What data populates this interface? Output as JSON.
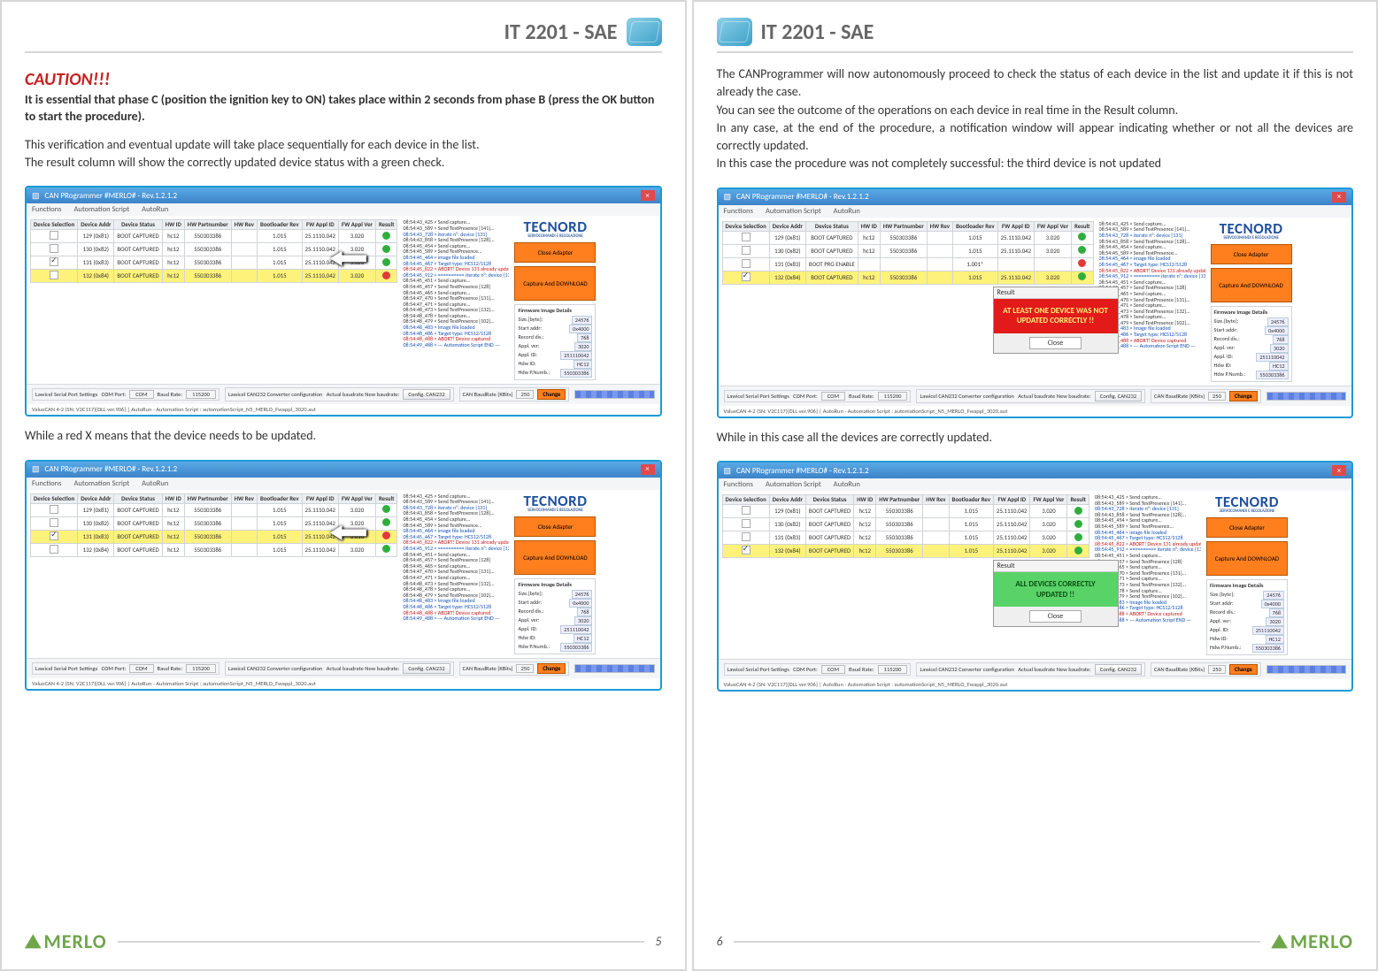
{
  "doc_title": "IT 2201 - SAE",
  "p5": {
    "caution": "CAUTION!!!",
    "caution_bold": "It is essential that phase C (position the ignition key to ON) takes place within 2 seconds from phase B (press the OK button to start the procedure).",
    "p1": "This verification and eventual update will take place sequentially for each device in the list.",
    "p2": "The result column will show the correctly updated device status with a green check.",
    "mid": "While a red X means that the device needs to be updated.",
    "num": "5"
  },
  "p6": {
    "p1": "The CANProgrammer will now autonomously proceed to check the status of each device in the list and update it if this is not already the case.",
    "p2": "You can see the outcome of the operations on each device in real time in the Result column.",
    "p3": "In any case, at the end of the procedure, a notification window will appear indicating whether or not all the devices are correctly updated.",
    "p4": "In this case the procedure was not completely successful: the third device is not updated",
    "mid": "While in this case all the devices are correctly updated.",
    "num": "6"
  },
  "win": {
    "title": "CAN PRogrammer #MERLO# - Rev.1.2.1.2",
    "menu": [
      "Functions",
      "Automation Script",
      "AutoRun"
    ],
    "headers": [
      "Device Selection",
      "Device Addr",
      "Device Status",
      "HW ID",
      "HW Partnumber",
      "HW Rev",
      "Bootloader Rev",
      "FW Appl ID",
      "FW Appl Ver",
      "Result"
    ],
    "btn_close_adapter": "Close Adapter",
    "btn_capture": "Capture And DOWNLOAD",
    "fw_panel_title": "Firmware Image Details",
    "fw_rows": [
      [
        "Size.[byte]:",
        "24576"
      ],
      [
        "Start addr:",
        "0x4000"
      ],
      [
        "Record dis.:",
        "768"
      ],
      [
        "Appl. ver:",
        "3020"
      ],
      [
        "Appl. ID:",
        "251110042"
      ],
      [
        "Hdw ID:",
        "HC12"
      ],
      [
        "Hdw P.Numb.:",
        "550303386"
      ]
    ],
    "tecnord_sub": "SERVOCOMANDI E REGOLAZIONE",
    "bar": {
      "g1": "Lawicel Serial Port Settings",
      "g1a": "COM Port:",
      "g1b": "Baud Rate:",
      "g2": "Lawicel CAN232 Converter configuration",
      "g2a": "Actual baudrate",
      "g2b": "New baudrate:",
      "g2btn": "Config. CAN232",
      "g3": "CAN BaudRate [KBits]",
      "g3val": "250",
      "g3btn": "Change"
    },
    "caption": "ValueCAN 4-2 (SN: V2C117)[DLL ver.906] | AutoRun - Automation Script : automationScript_N5_MERLO_Fwappl_3020.aut"
  },
  "s1": {
    "rows": [
      {
        "sel": false,
        "addr": "129  (0x81)",
        "status": "BOOT CAPTURED",
        "hw": "hc12",
        "pn": "550303386",
        "rev": "",
        "bl": "1.015",
        "id": "25.1110.042",
        "ver": "3.020",
        "ok": true,
        "hi": false
      },
      {
        "sel": false,
        "addr": "130  (0x82)",
        "status": "BOOT CAPTURED",
        "hw": "hc12",
        "pn": "550303386",
        "rev": "",
        "bl": "1.015",
        "id": "25.1110.042",
        "ver": "3.020",
        "ok": true,
        "hi": false
      },
      {
        "sel": true,
        "addr": "131  (0x83)",
        "status": "BOOT CAPTURED",
        "hw": "hc12",
        "pn": "550303386",
        "rev": "",
        "bl": "1.015",
        "id": "25.1110.042",
        "ver": "3.020",
        "ok": true,
        "hi": false
      },
      {
        "sel": false,
        "addr": "132  (0x84)",
        "status": "BOOT CAPTURED",
        "hw": "hc12",
        "pn": "550303386",
        "rev": "",
        "bl": "1.015",
        "id": "25.1110.042",
        "ver": "3.020",
        "ok": false,
        "hi": true
      }
    ],
    "log": [
      "08:54:43_425 > Send capture...",
      "08:54:43_589 > Send TestPresence [141]...",
      "08:54:43_728 > iterate n°: device [131]",
      "08:54:43_858 > Send TestPresence [128]...",
      "08:54:45_454 > Send capture...",
      "08:54:45_589 > Send TestPresence...",
      "08:54:45_464 > image file loaded",
      "08:54:45_467 > Target type: HCS12/S128",
      "08:54:45_822 > ABORT! Device 131 already updated",
      "08:54:45_912 > ========== iterate n°: device [132]",
      "08:54:45_451 > Send capture...",
      "08:54:45_457 > Send TestPresence [128]",
      "08:54:45_465 > Send capture...",
      "08:54:47_470 > Send TestPresence [131]...",
      "08:54:47_471 > Send capture...",
      "08:54:48_473 > Send TestPresence [132]...",
      "08:54:48_478 > Send capture...",
      "08:54:48_479 > Send TestPresence [102]...",
      "08:54:48_483 > Image file loaded",
      "08:54:48_486 > Target type: HCS12/S128",
      "08:54:48_488 > ABORT! Device captured",
      "08:54:49_488 > --- Automation Script END ---"
    ]
  },
  "s2": {
    "rows": [
      {
        "sel": false,
        "addr": "129  (0x81)",
        "status": "BOOT CAPTURED",
        "hw": "hc12",
        "pn": "550303386",
        "rev": "",
        "bl": "1.015",
        "id": "25.1110.042",
        "ver": "3.020",
        "ok": true,
        "hi": false
      },
      {
        "sel": false,
        "addr": "130  (0x82)",
        "status": "BOOT CAPTURED",
        "hw": "hc12",
        "pn": "550303386",
        "rev": "",
        "bl": "1.015",
        "id": "25.1110.042",
        "ver": "3.020",
        "ok": true,
        "hi": false
      },
      {
        "sel": true,
        "addr": "131  (0x83)",
        "status": "BOOT CAPTURED",
        "hw": "hc12",
        "pn": "550303386",
        "rev": "",
        "bl": "1.015",
        "id": "25.1110.042",
        "ver": "3.010",
        "ok": false,
        "hi": true
      },
      {
        "sel": false,
        "addr": "132  (0x84)",
        "status": "BOOT CAPTURED",
        "hw": "hc12",
        "pn": "550303386",
        "rev": "",
        "bl": "1.015",
        "id": "25.1110.042",
        "ver": "3.020",
        "ok": true,
        "hi": false
      }
    ]
  },
  "s3": {
    "rows": [
      {
        "sel": false,
        "addr": "129  (0x81)",
        "status": "BOOT CAPTURED",
        "hw": "hc12",
        "pn": "550303386",
        "rev": "",
        "bl": "1.015",
        "id": "25.1110.042",
        "ver": "3.020",
        "ok": true,
        "hi": false
      },
      {
        "sel": false,
        "addr": "130  (0x82)",
        "status": "BOOT CAPTURED",
        "hw": "hc12",
        "pn": "550303386",
        "rev": "",
        "bl": "1.015",
        "id": "25.1110.042",
        "ver": "3.020",
        "ok": true,
        "hi": false
      },
      {
        "sel": false,
        "addr": "131  (0x83)",
        "status": "BOOT PRG ENABLE",
        "hw": "",
        "pn": "",
        "rev": "",
        "bl": "1.001*",
        "id": "",
        "ver": "",
        "ok": false,
        "hi": false
      },
      {
        "sel": true,
        "addr": "132  (0x84)",
        "status": "BOOT CAPTURED",
        "hw": "hc12",
        "pn": "550303386",
        "rev": "",
        "bl": "1.015",
        "id": "25.1110.042",
        "ver": "3.020",
        "ok": true,
        "hi": true
      }
    ],
    "modal_title": "Result",
    "modal_body": "AT LEAST ONE DEVICE WAS NOT UPDATED CORRECTLY !!",
    "modal_close": "Close"
  },
  "s4": {
    "rows": [
      {
        "sel": false,
        "addr": "129  (0x81)",
        "status": "BOOT CAPTURED",
        "hw": "hc12",
        "pn": "550303386",
        "rev": "",
        "bl": "1.015",
        "id": "25.1110.042",
        "ver": "3.020",
        "ok": true,
        "hi": false
      },
      {
        "sel": false,
        "addr": "130  (0x82)",
        "status": "BOOT CAPTURED",
        "hw": "hc12",
        "pn": "550303386",
        "rev": "",
        "bl": "1.015",
        "id": "25.1110.042",
        "ver": "3.020",
        "ok": true,
        "hi": false
      },
      {
        "sel": false,
        "addr": "131  (0x83)",
        "status": "BOOT CAPTURED",
        "hw": "hc12",
        "pn": "550303386",
        "rev": "",
        "bl": "1.015",
        "id": "25.1110.042",
        "ver": "3.020",
        "ok": true,
        "hi": false
      },
      {
        "sel": true,
        "addr": "132  (0x84)",
        "status": "BOOT CAPTURED",
        "hw": "hc12",
        "pn": "550303386",
        "rev": "",
        "bl": "1.015",
        "id": "25.1110.042",
        "ver": "3.020",
        "ok": true,
        "hi": true
      }
    ],
    "modal_title": "Result",
    "modal_body": "ALL DEVICES CORRECTLY UPDATED !!",
    "modal_close": "Close"
  },
  "merlo": "MERLO",
  "tecnord": "TECNORD"
}
